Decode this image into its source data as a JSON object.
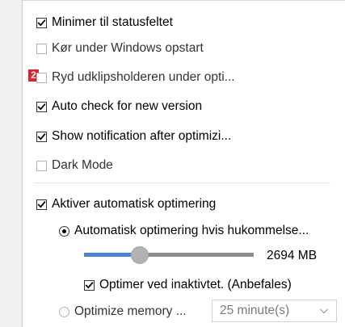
{
  "settings": {
    "minimize_tray": {
      "label": "Minimer til statusfeltet",
      "checked": true
    },
    "run_startup": {
      "label": "Kør under Windows opstart",
      "checked": false
    },
    "clear_clipboard": {
      "label": "Ryd udklipsholderen under opti...",
      "checked": false
    },
    "auto_check": {
      "label": "Auto check for new version",
      "checked": true
    },
    "show_notification": {
      "label": "Show notification after optimizi...",
      "checked": true
    },
    "dark_mode": {
      "label": "Dark Mode",
      "checked": false
    }
  },
  "badge": {
    "label": "2",
    "color": "#e0202a"
  },
  "auto_opt": {
    "enable": {
      "label": "Aktiver automatisk optimering",
      "checked": true
    },
    "memory_mode": {
      "label": "Automatisk optimering hvis hukommelse...",
      "selected": true
    },
    "threshold": {
      "value_label": "2694 MB",
      "fraction": 0.33,
      "accent": "#4a86c9"
    },
    "idle": {
      "label": "Optimer ved inaktivtet. (Anbefales)",
      "checked": true
    },
    "interval_mode": {
      "label": "Optimize memory ...",
      "selected": false
    },
    "interval": {
      "value": "25 minute(s)"
    }
  }
}
